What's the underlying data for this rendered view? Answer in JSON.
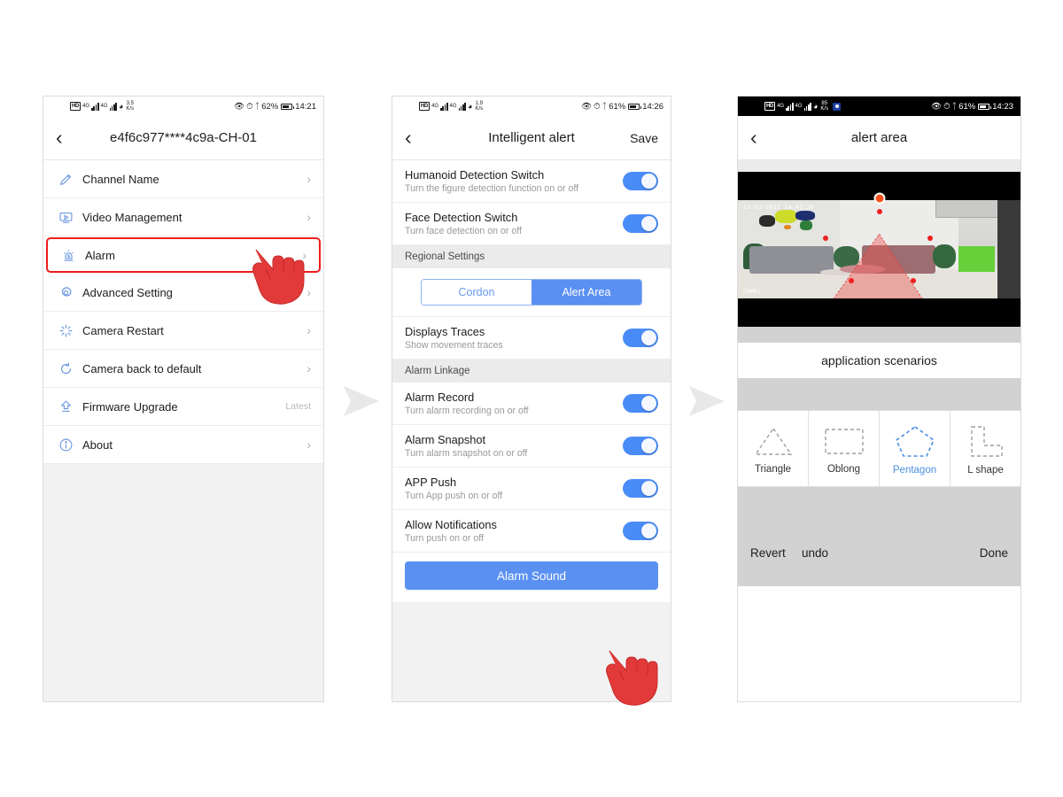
{
  "screens": [
    {
      "id": "device-settings",
      "status": {
        "hd": "HD",
        "net1": "4G",
        "net2": "4G",
        "rate": "3.5",
        "rate_unit": "K/s",
        "battery": "62%",
        "time": "14:21"
      },
      "nav": {
        "back": "‹",
        "title": "e4f6c977****4c9a-CH-01",
        "action": ""
      },
      "rows": [
        {
          "icon": "pencil-icon",
          "label": "Channel Name",
          "hint": "",
          "chevron": "›",
          "highlight": false
        },
        {
          "icon": "video-icon",
          "label": "Video Management",
          "hint": "",
          "chevron": "›",
          "highlight": false
        },
        {
          "icon": "alarm-icon",
          "label": "Alarm",
          "hint": "",
          "chevron": "›",
          "highlight": true
        },
        {
          "icon": "gear-icon",
          "label": "Advanced Setting",
          "hint": "",
          "chevron": "›",
          "highlight": false
        },
        {
          "icon": "restart-icon",
          "label": "Camera Restart",
          "hint": "",
          "chevron": "›",
          "highlight": false
        },
        {
          "icon": "refresh-icon",
          "label": "Camera back to default",
          "hint": "",
          "chevron": "›",
          "highlight": false
        },
        {
          "icon": "upgrade-icon",
          "label": "Firmware Upgrade",
          "hint": "Latest",
          "chevron": "",
          "highlight": false
        },
        {
          "icon": "info-icon",
          "label": "About",
          "hint": "",
          "chevron": "›",
          "highlight": false
        }
      ]
    },
    {
      "id": "intelligent-alert",
      "status": {
        "hd": "HD",
        "net1": "4G",
        "net2": "4G",
        "rate": "1.9",
        "rate_unit": "K/s",
        "battery": "61%",
        "time": "14:26"
      },
      "nav": {
        "back": "‹",
        "title": "Intelligent alert",
        "action": "Save"
      },
      "toggles_top": [
        {
          "title": "Humanoid Detection Switch",
          "subtitle": "Turn the figure detection function on or off",
          "on": true
        },
        {
          "title": "Face Detection Switch",
          "subtitle": "Turn face detection on or off",
          "on": true
        }
      ],
      "regional_header": "Regional Settings",
      "segmented": {
        "options": [
          "Cordon",
          "Alert Area"
        ],
        "selected": "Alert Area"
      },
      "traces": {
        "title": "Displays Traces",
        "subtitle": "Show movement traces",
        "on": true
      },
      "linkage_header": "Alarm Linkage",
      "toggles_linkage": [
        {
          "title": "Alarm Record",
          "subtitle": "Turn alarm recording on or off",
          "on": true
        },
        {
          "title": "Alarm Snapshot",
          "subtitle": "Turn alarm snapshot on or off",
          "on": true
        },
        {
          "title": "APP Push",
          "subtitle": "Turn App push on or off",
          "on": true
        },
        {
          "title": "Allow Notifications",
          "subtitle": "Turn push on or off",
          "on": true
        }
      ],
      "alarm_sound_button": "Alarm Sound"
    },
    {
      "id": "alert-area",
      "status": {
        "hd": "HD",
        "net1": "4G",
        "net2": "4G",
        "rate": "85",
        "rate_unit": "K/s",
        "battery": "61%",
        "time": "14:23",
        "extra_icon": "blue-square-icon"
      },
      "nav": {
        "back": "‹",
        "title": "alert area",
        "action": ""
      },
      "video": {
        "timestamp": "12-02-2022 14:42:20",
        "channel": "CAM01"
      },
      "scenarios_label": "application scenarios",
      "shapes": [
        {
          "name": "Triangle",
          "selected": false
        },
        {
          "name": "Oblong",
          "selected": false
        },
        {
          "name": "Pentagon",
          "selected": true
        },
        {
          "name": "L shape",
          "selected": false
        }
      ],
      "actions": {
        "revert": "Revert",
        "undo": "undo",
        "done": "Done"
      }
    }
  ],
  "flow": {
    "arrow": "▶",
    "count": 2
  },
  "colors": {
    "accent_blue": "#4a8cf7",
    "segment_blue": "#5a90f2",
    "highlight_red": "#ee1c1c",
    "hand_red": "#e03030",
    "section_gray": "#ebebeb",
    "band_gray": "#d2d2d2",
    "shape_selected": "#4a90e2",
    "vertex_red": "#f02020"
  }
}
